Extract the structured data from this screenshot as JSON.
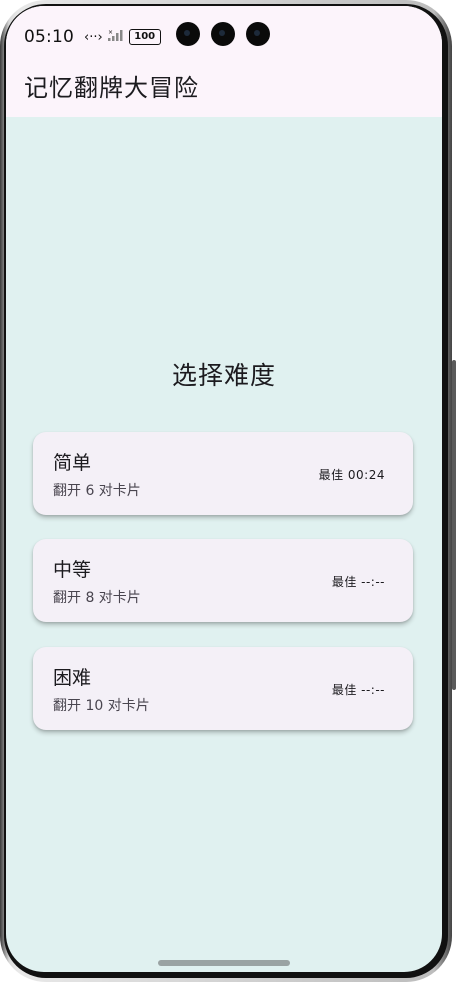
{
  "status_bar": {
    "time": "05:10",
    "battery": "100"
  },
  "app_bar": {
    "title": "记忆翻牌大冒险"
  },
  "main": {
    "heading": "选择难度",
    "levels": [
      {
        "name": "简单",
        "pairs": "翻开 6 对卡片",
        "best": "最佳 00:24"
      },
      {
        "name": "中等",
        "pairs": "翻开 8 对卡片",
        "best": "最佳 --:--"
      },
      {
        "name": "困难",
        "pairs": "翻开 10 对卡片",
        "best": "最佳 --:--"
      }
    ]
  },
  "colors": {
    "app_bar_bg": "#fcf4fb",
    "screen_bg": "#e0f1f0",
    "card_bg": "#f4f0f7",
    "text_primary": "#1c1b1f"
  }
}
